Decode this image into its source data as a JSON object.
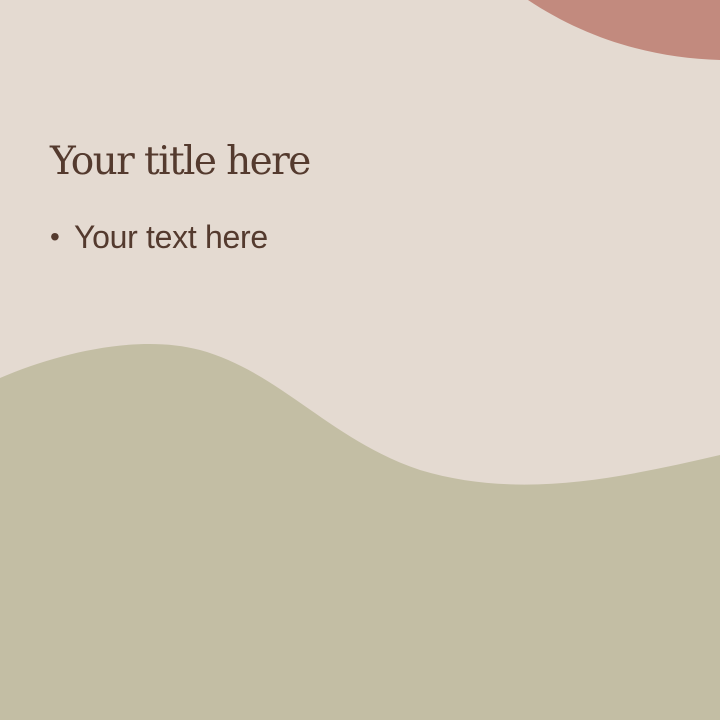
{
  "slide": {
    "title": "Your title here",
    "bullets": [
      {
        "marker": "•",
        "text": "Your text here"
      }
    ]
  },
  "colors": {
    "background": "#E4DAD1",
    "wave": "#C3BEA4",
    "blob": "#C28A7E",
    "text": "#543A2E"
  }
}
